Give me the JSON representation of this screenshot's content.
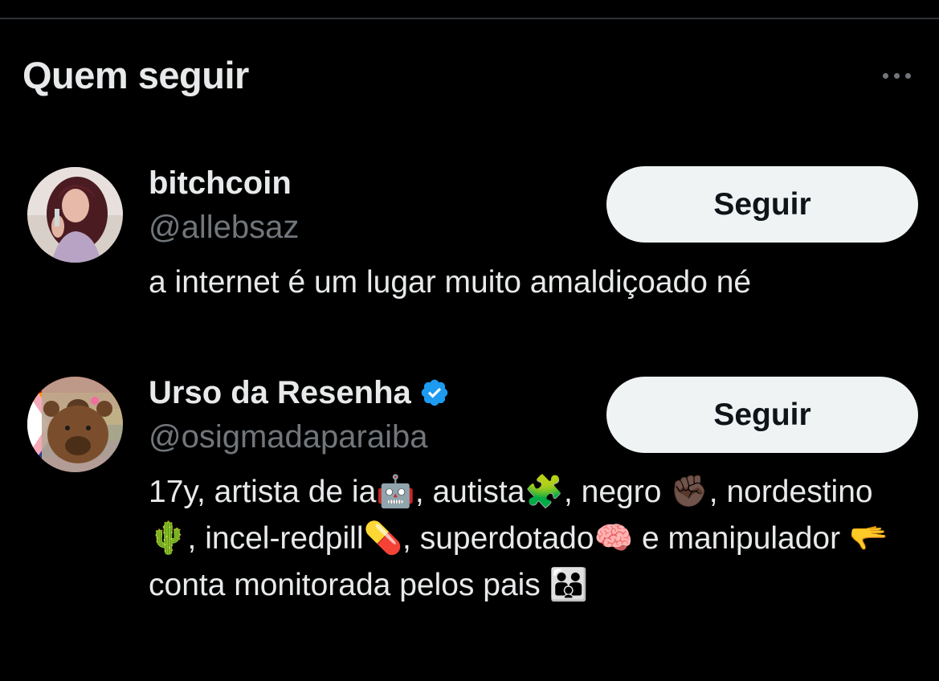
{
  "panel": {
    "title": "Quem seguir",
    "more_icon": "more-horizontal-icon"
  },
  "colors": {
    "background": "#000000",
    "primary_text": "#e7e9ea",
    "secondary_text": "#71767b",
    "button_bg": "#eff3f4",
    "button_text": "#0f1419",
    "verified": "#1d9bf0"
  },
  "users": [
    {
      "name": "bitchcoin",
      "handle": "@allebsaz",
      "bio": "a internet é um lugar muito amaldiçoado né",
      "verified": false,
      "follow_label": "Seguir"
    },
    {
      "name": "Urso da Resenha",
      "handle": "@osigmadaparaiba",
      "bio": "17y, artista de ia🤖, autista🧩, negro ✊🏿, nordestino 🌵, incel-redpill💊, superdotado🧠 e manipulador 🫳 conta monitorada pelos pais 👪",
      "verified": true,
      "verified_icon": "verified-badge-icon",
      "follow_label": "Seguir"
    }
  ]
}
